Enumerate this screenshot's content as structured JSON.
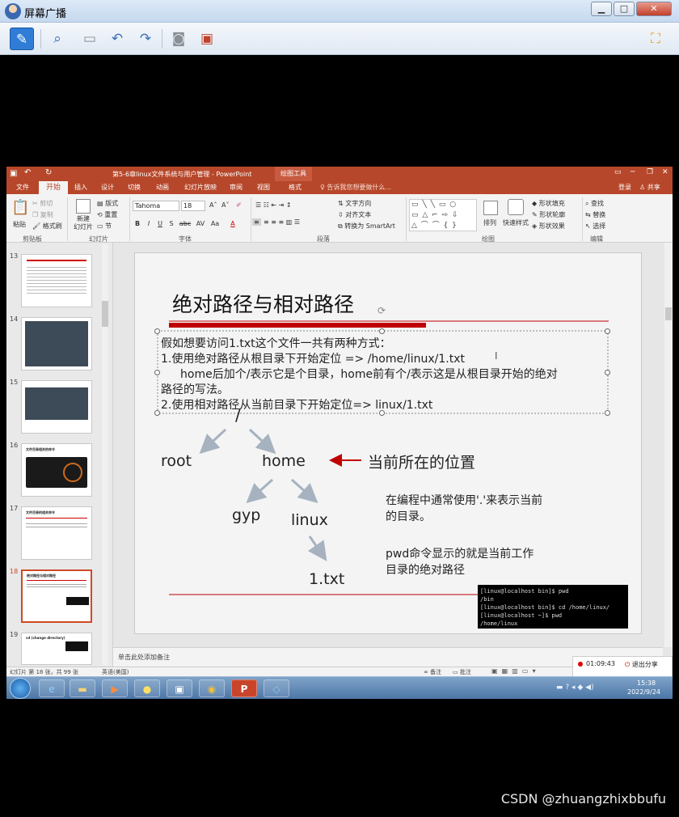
{
  "outer": {
    "title": "屏幕广播",
    "min": "▁",
    "max": "□",
    "close": "✕"
  },
  "ppt": {
    "title": "第5-6章linux文件系统与用户管理 - PowerPoint",
    "drawing_tools": "绘图工具",
    "login": "登录",
    "share": "共享",
    "tell_me": "告诉我您想要做什么...",
    "tabs": [
      "文件",
      "开始",
      "插入",
      "设计",
      "切换",
      "动画",
      "幻灯片放映",
      "审阅",
      "视图",
      "格式"
    ],
    "ribbon": {
      "paste": "粘贴",
      "cut": "剪切",
      "copy": "复制",
      "format_painter": "格式刷",
      "clipboard": "剪贴板",
      "new_slide": "新建\n幻灯片",
      "layout": "版式",
      "reset": "重置",
      "section": "节",
      "slides": "幻灯片",
      "font_name": "Tahoma",
      "font_size": "18",
      "font": "字体",
      "text_direction": "文字方向",
      "align_text": "对齐文本",
      "convert_smartart": "转换为 SmartArt",
      "paragraph": "段落",
      "arrange": "排列",
      "quick_styles": "快速样式",
      "shape_fill": "形状填充",
      "shape_outline": "形状轮廓",
      "shape_effects": "形状效果",
      "drawing": "绘图",
      "find": "查找",
      "replace": "替换",
      "select": "选择",
      "editing": "编辑"
    },
    "thumb_numbers": [
      "13",
      "14",
      "15",
      "16",
      "17",
      "18",
      "19"
    ],
    "thumb_texts": {
      "16": "文件目录相关的命令",
      "17": "文件目录的相关命令",
      "18": "绝对路径与相对路径",
      "19": "cd (change directory)"
    },
    "notes_placeholder": "单击此处添加备注",
    "status": {
      "slide_info": "幻灯片 第 18 张，共 99 张",
      "lang": "英语(美国)",
      "notes": "备注",
      "comments": "批注",
      "record_time": "01:09:43",
      "exit_share": "退出分享"
    }
  },
  "slide": {
    "title": "绝对路径与相对路径",
    "lines": [
      "假如想要访问1.txt这个文件一共有两种方式：",
      "1.使用绝对路径从根目录下开始定位 => /home/linux/1.txt",
      "home后加个/表示它是个目录，home前有个/表示这是从根目录开始的绝对",
      "路径的写法。",
      "2.使用相对路径从当前目录下开始定位=> linux/1.txt"
    ],
    "tree": {
      "root_dir": "/",
      "root": "root",
      "home": "home",
      "gyp": "gyp",
      "linux": "linux",
      "file": "1.txt"
    },
    "current_label": "当前所在的位置",
    "note1": [
      "在编程中通常使用'.'来表示当前",
      "的目录。"
    ],
    "note2": [
      "pwd命令显示的就是当前工作",
      "目录的绝对路径"
    ],
    "terminal": [
      "[linux@localhost bin]$ pwd",
      "/bin",
      "[linux@localhost bin]$ cd /home/linux/",
      "[linux@localhost ~]$ pwd",
      "/home/linux"
    ]
  },
  "taskbar": {
    "time": "15:38",
    "date": "2022/9/24"
  },
  "watermark": "CSDN @zhuangzhixbbufu",
  "colors": {
    "accent": "#b7472a",
    "slide_red": "#c00000",
    "arrow_gray": "#a6b2bf",
    "taskbar": "#4c76a6"
  }
}
